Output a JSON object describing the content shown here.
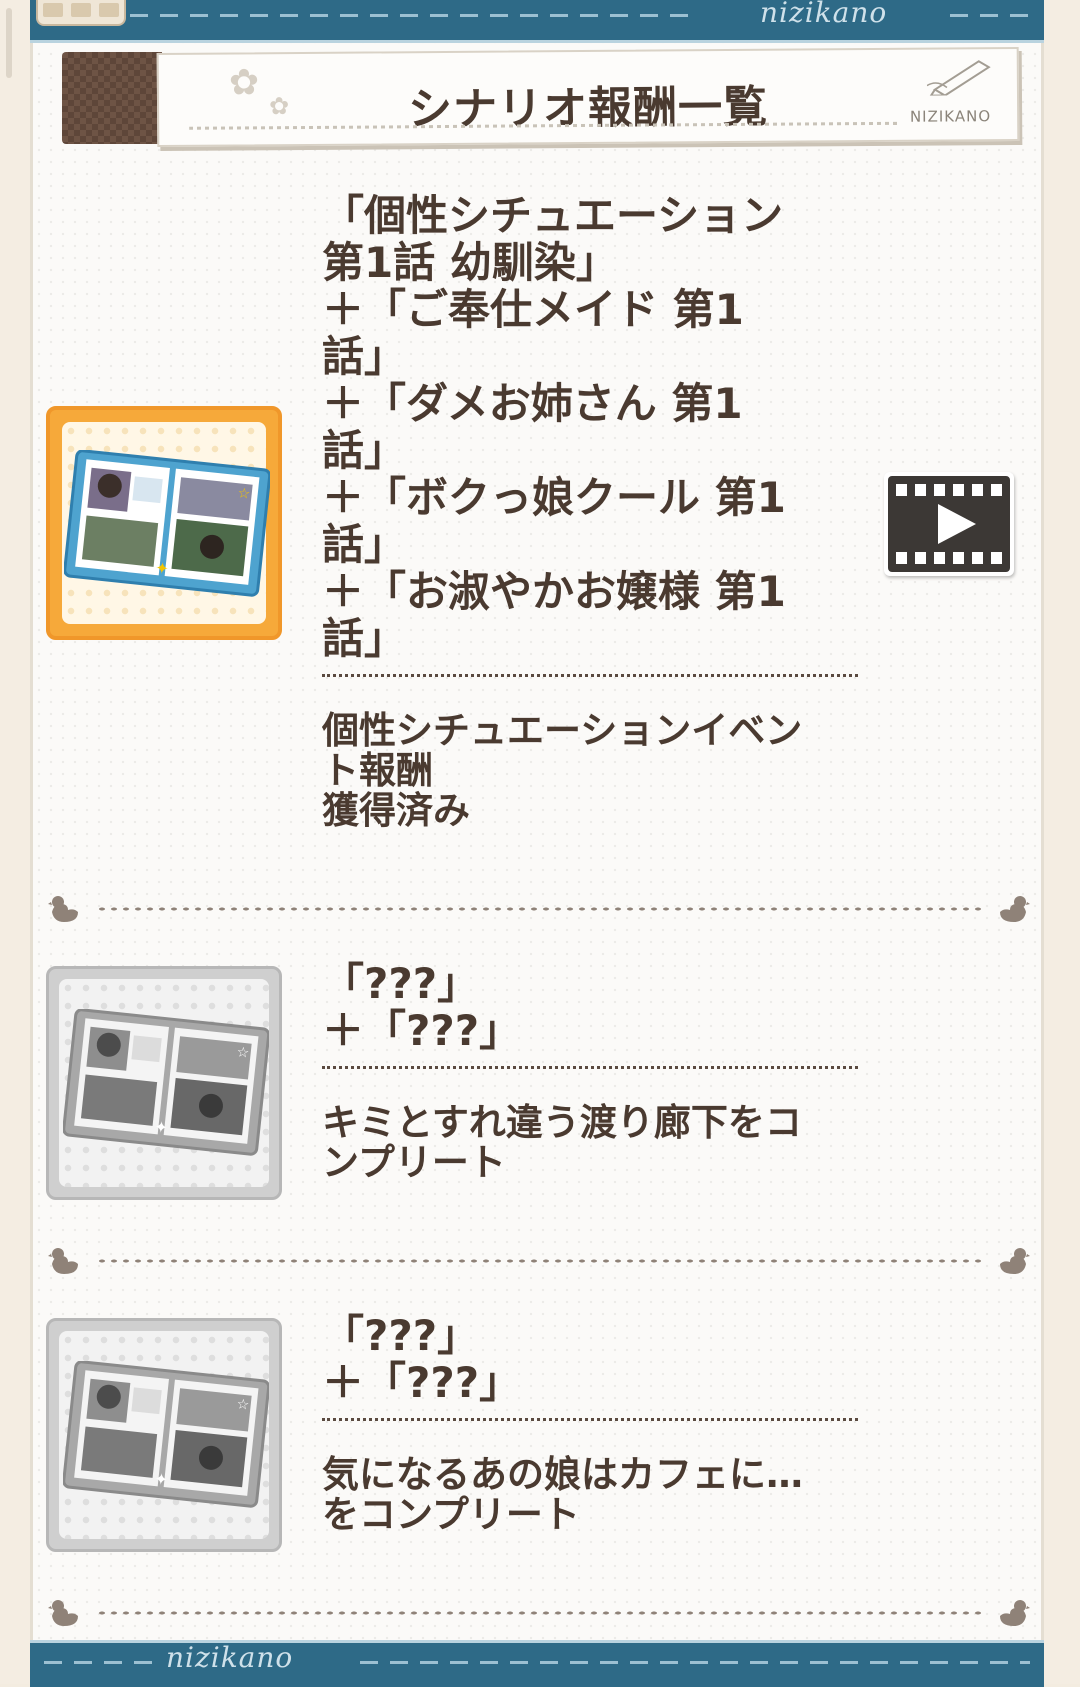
{
  "header": {
    "brand": "nizikano",
    "title": "シナリオ報酬一覧",
    "stamp": "NIZIKANO"
  },
  "footer": {
    "brand": "nizikano"
  },
  "rewards": [
    {
      "scenario": "「個性シチュエーション\n第1話 幼馴染」\n＋「ご奉仕メイド 第1\n話」\n＋「ダメお姉さん 第1\n話」\n＋「ボクっ娘クール 第1\n話」\n＋「お淑やかお嬢様 第1\n話」",
      "condition": "個性シチュエーションイベン\nト報酬\n獲得済み",
      "unlocked": true,
      "has_play_button": true
    },
    {
      "scenario": "「???」\n＋「???」",
      "condition": "キミとすれ違う渡り廊下をコ\nンプリート",
      "unlocked": false,
      "has_play_button": false
    },
    {
      "scenario": "「???」\n＋「???」",
      "condition": "気になるあの娘はカフェに…\nをコンプリート",
      "unlocked": false,
      "has_play_button": false
    }
  ],
  "icons": {
    "album": "photo-album-icon",
    "play": "film-play-icon",
    "divider": "duck-icon",
    "pencil": "pencil-icon"
  },
  "colors": {
    "header_blue": "#2e6a87",
    "text_brown": "#4a3a30",
    "unlocked_frame": "#f6a93a",
    "locked_frame": "#cfcfcf"
  }
}
